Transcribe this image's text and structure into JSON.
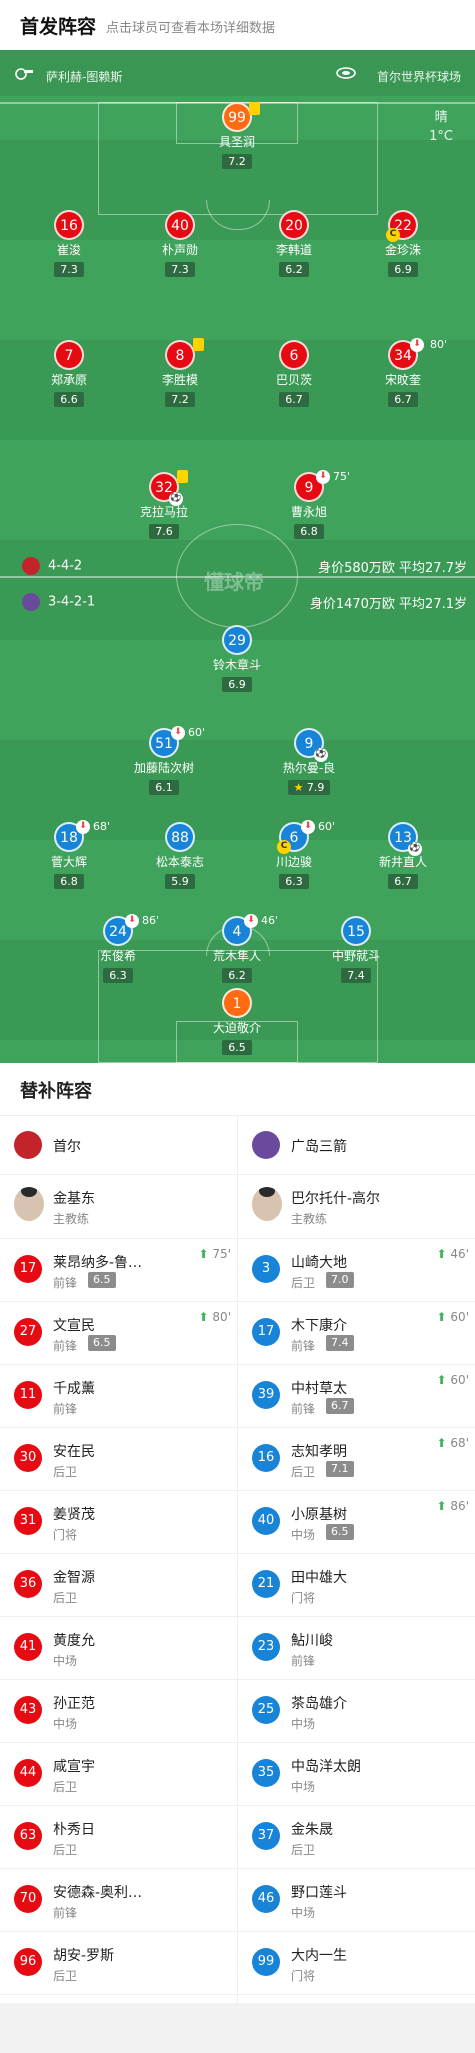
{
  "header": {
    "title": "首发阵容",
    "subtitle": "点击球员可查看本场详细数据"
  },
  "field": {
    "referee": "萨利赫-图赖斯",
    "stadium": "首尔世界杯球场",
    "weather": "晴",
    "temperature": "1°C",
    "watermark": "懂球帝",
    "home_formation": "4-4-2",
    "home_info": "身价580万欧 平均27.7岁",
    "away_formation": "3-4-2-1",
    "away_info": "身价1470万欧 平均27.1岁",
    "home_players": [
      {
        "num": "99",
        "name": "具圣润",
        "rating": "7.2"
      },
      {
        "num": "16",
        "name": "崔浚",
        "rating": "7.3"
      },
      {
        "num": "40",
        "name": "朴声勋",
        "rating": "7.3"
      },
      {
        "num": "20",
        "name": "李韩道",
        "rating": "6.2"
      },
      {
        "num": "22",
        "name": "金珍洙",
        "rating": "6.9"
      },
      {
        "num": "7",
        "name": "郑承原",
        "rating": "6.6"
      },
      {
        "num": "8",
        "name": "李胜模",
        "rating": "7.2"
      },
      {
        "num": "6",
        "name": "巴贝茨",
        "rating": "6.7"
      },
      {
        "num": "34",
        "name": "宋旼奎",
        "rating": "6.7",
        "subtime": "80'"
      },
      {
        "num": "32",
        "name": "克拉马拉",
        "rating": "7.6"
      },
      {
        "num": "9",
        "name": "曹永旭",
        "rating": "6.8",
        "subtime": "75'"
      }
    ],
    "away_players": [
      {
        "num": "29",
        "name": "铃木章斗",
        "rating": "6.9"
      },
      {
        "num": "51",
        "name": "加藤陆次树",
        "rating": "6.1",
        "subtime": "60'"
      },
      {
        "num": "9",
        "name": "热尔曼-良",
        "rating": "7.9"
      },
      {
        "num": "18",
        "name": "菅大辉",
        "rating": "6.8",
        "subtime": "68'"
      },
      {
        "num": "88",
        "name": "松本泰志",
        "rating": "5.9"
      },
      {
        "num": "6",
        "name": "川边骏",
        "rating": "6.3",
        "subtime": "60'"
      },
      {
        "num": "13",
        "name": "新井直人",
        "rating": "6.7"
      },
      {
        "num": "24",
        "name": "东俊希",
        "rating": "6.3",
        "subtime": "86'"
      },
      {
        "num": "4",
        "name": "荒木隼人",
        "rating": "6.2",
        "subtime": "46'"
      },
      {
        "num": "15",
        "name": "中野就斗",
        "rating": "7.4"
      },
      {
        "num": "1",
        "name": "大迫敬介",
        "rating": "6.5"
      }
    ]
  },
  "subs": {
    "title": "替补阵容",
    "home": {
      "team": "首尔",
      "coach": "金基东",
      "coach_role": "主教练",
      "players": [
        {
          "num": "17",
          "name": "莱昂纳多-鲁…",
          "pos": "前锋",
          "rating": "6.5",
          "event": "75'"
        },
        {
          "num": "27",
          "name": "文宣民",
          "pos": "前锋",
          "rating": "6.5",
          "event": "80'"
        },
        {
          "num": "11",
          "name": "千成薰",
          "pos": "前锋"
        },
        {
          "num": "30",
          "name": "安在民",
          "pos": "后卫"
        },
        {
          "num": "31",
          "name": "姜贤茂",
          "pos": "门将"
        },
        {
          "num": "36",
          "name": "金智源",
          "pos": "后卫"
        },
        {
          "num": "41",
          "name": "黄度允",
          "pos": "中场"
        },
        {
          "num": "43",
          "name": "孙正范",
          "pos": "中场"
        },
        {
          "num": "44",
          "name": "咸宣宇",
          "pos": "后卫"
        },
        {
          "num": "63",
          "name": "朴秀日",
          "pos": "后卫"
        },
        {
          "num": "70",
          "name": "安德森-奥利…",
          "pos": "前锋"
        },
        {
          "num": "96",
          "name": "胡安-罗斯",
          "pos": "后卫"
        }
      ]
    },
    "away": {
      "team": "广岛三箭",
      "coach": "巴尔托什-高尔",
      "coach_role": "主教练",
      "players": [
        {
          "num": "3",
          "name": "山崎大地",
          "pos": "后卫",
          "rating": "7.0",
          "event": "46'"
        },
        {
          "num": "17",
          "name": "木下康介",
          "pos": "前锋",
          "rating": "7.4",
          "event": "60'"
        },
        {
          "num": "39",
          "name": "中村草太",
          "pos": "前锋",
          "rating": "6.7",
          "event": "60'"
        },
        {
          "num": "16",
          "name": "志知孝明",
          "pos": "后卫",
          "rating": "7.1",
          "event": "68'"
        },
        {
          "num": "40",
          "name": "小原基树",
          "pos": "中场",
          "rating": "6.5",
          "event": "86'"
        },
        {
          "num": "21",
          "name": "田中雄大",
          "pos": "门将"
        },
        {
          "num": "23",
          "name": "鮎川峻",
          "pos": "前锋"
        },
        {
          "num": "25",
          "name": "茶岛雄介",
          "pos": "中场"
        },
        {
          "num": "35",
          "name": "中岛洋太朗",
          "pos": "中场"
        },
        {
          "num": "37",
          "name": "金朱晟",
          "pos": "后卫"
        },
        {
          "num": "46",
          "name": "野口莲斗",
          "pos": "中场"
        },
        {
          "num": "99",
          "name": "大内一生",
          "pos": "门将"
        }
      ]
    }
  }
}
